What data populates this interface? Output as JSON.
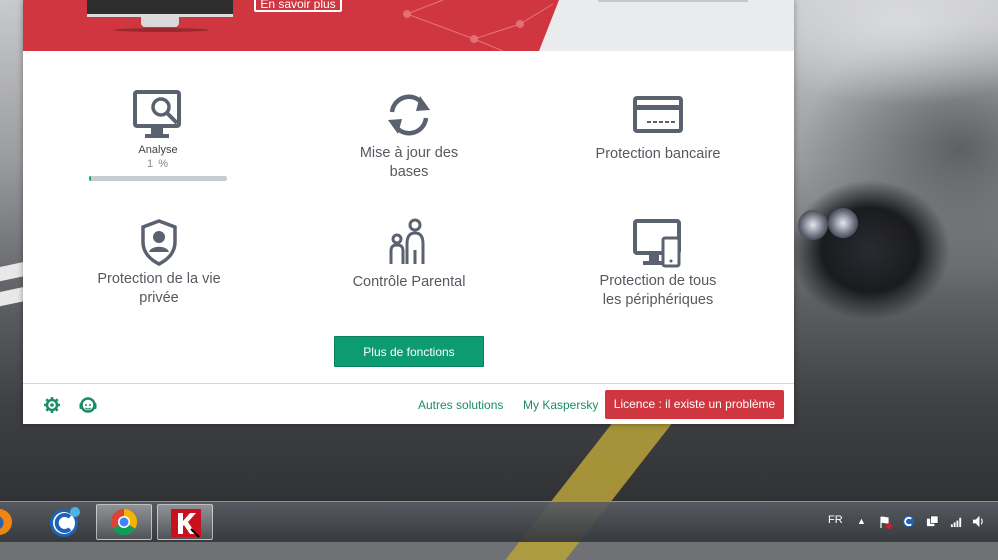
{
  "banner": {
    "learn_more_label": "En savoir plus"
  },
  "tiles": {
    "scan": {
      "label": "Analyse",
      "progress_text": "1 %",
      "progress": 0.01
    },
    "update": {
      "label_line1": "Mise à jour des",
      "label_line2": "bases"
    },
    "bank": {
      "label": "Protection bancaire"
    },
    "privacy": {
      "label_line1": "Protection de la vie",
      "label_line2": "privée"
    },
    "parental": {
      "label": "Contrôle Parental"
    },
    "devices": {
      "label_line1": "Protection de tous",
      "label_line2": "les périphériques"
    }
  },
  "more_button_label": "Plus de fonctions",
  "footer": {
    "settings_icon": "gear-icon",
    "support_icon": "support-agent-icon",
    "other_solutions": "Autres solutions",
    "my_kaspersky": "My Kaspersky",
    "license_label": "Licence : il existe un problème"
  },
  "taskbar": {
    "items": [
      "firefox",
      "ccleaner",
      "chrome",
      "kaspersky"
    ],
    "language": "FR"
  },
  "colors": {
    "brand_red": "#d0363f",
    "action_green": "#0d9b73",
    "link_green": "#1a8c66",
    "icon_grey": "#5a6270"
  }
}
